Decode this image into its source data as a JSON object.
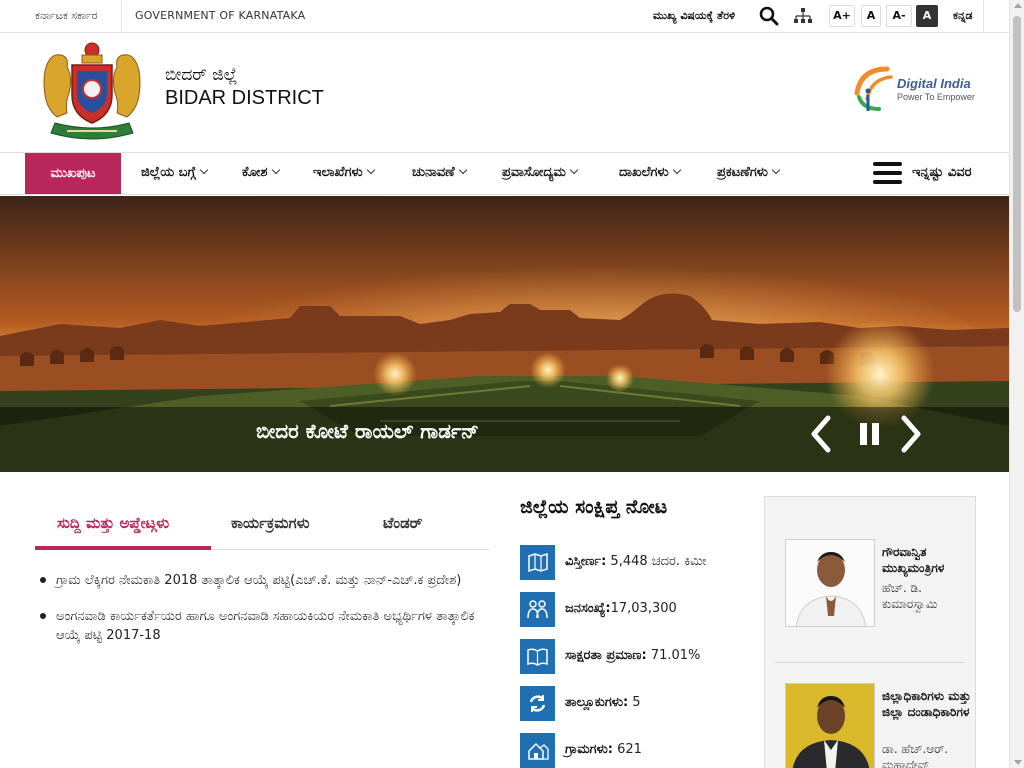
{
  "topbar": {
    "gov_kn": "ಕರ್ನಾಟಕ ಸರ್ಕಾರ",
    "gov_en": "GOVERNMENT OF KARNATAKA",
    "skip_to_main": "ಮುಖ್ಯ ವಿಷಯಕ್ಕೆ ತೆರಳಿ",
    "font_increase": "A+",
    "font_normal": "A",
    "font_decrease": "A-",
    "high_contrast": "A",
    "language": "ಕನ್ನಡ",
    "search_icon": "search-icon",
    "sitemap_icon": "sitemap-icon"
  },
  "header": {
    "title_kn": "ಬೀದರ್ ಜಿಲ್ಲೆ",
    "title_en": "BIDAR DISTRICT",
    "digital_india_title": "Digital India",
    "digital_india_sub": "Power To Empower"
  },
  "nav": {
    "home": "ಮುಖಪುಟ",
    "items": [
      {
        "label": "ಜಿಲ್ಲೆಯ ಬಗ್ಗೆ"
      },
      {
        "label": "ಕೋಶ"
      },
      {
        "label": "ಇಲಾಖೆಗಳು"
      },
      {
        "label": "ಚುನಾವಣೆ"
      },
      {
        "label": "ಪ್ರವಾಸೋದ್ಯಮ"
      },
      {
        "label": "ದಾಖಲೆಗಳು"
      },
      {
        "label": "ಪ್ರಕಟಣೆಗಳು"
      }
    ],
    "more": "ಇನ್ನಷ್ಟು ವಿವರ"
  },
  "banner": {
    "caption": "ಬೀದರ ಕೋಟೆ ರಾಯಲ್ ಗಾರ್ಡನ್",
    "colors": {
      "sky_top": "#4a2a1c",
      "sky_glow": "#e08a3a",
      "ground": "#3e4a22"
    }
  },
  "tabs": {
    "items": [
      {
        "label": "ಸುದ್ದಿ ಮತ್ತು ಅಪ್ಡೇಟ್ಗಳು",
        "active": true
      },
      {
        "label": "ಕಾರ್ಯಕ್ರಮಗಳು",
        "active": false
      },
      {
        "label": "ಟೆಂಡರ್",
        "active": false
      }
    ],
    "news": [
      "ಗ್ರಾಮ ಲೆಕ್ಕಿಗರ ನೇಮಕಾತಿ 2018 ತಾತ್ಕಾಲಿಕ ಆಯ್ಕೆ ಪಟ್ಟಿ(ಎಚ್.ಕೆ. ಮತ್ತು ನಾನ್-ಎಚ್.ಕ ಪ್ರದೇಶ)",
      "ಅಂಗನವಾಡಿ ಕಾರ್ಯಕರ್ತೆಯರ ಹಾಗೂ ಅಂಗನವಾಡಿ ಸಹಾಯಕಿಯರ ನೇಮಕಾತಿ ಅಭ್ಯರ್ಥಿಗಳ ತಾತ್ಕಾಲಿಕ ಆಯ್ಕೆ ಪಟ್ಟಿ 2017-18"
    ]
  },
  "snapshot": {
    "title": "ಜಿಲ್ಲೆಯ ಸಂಕ್ಷಿಪ್ತ ನೋಟ",
    "stats": [
      {
        "label": "ವಿಸ್ತೀರ್ಣ:",
        "value": " 5,448 ಚದರ. ಕಿಮೀ",
        "icon": "map-icon"
      },
      {
        "label": "ಜನಸಂಖ್ಯೆ:",
        "value": "17,03,300",
        "icon": "people-icon"
      },
      {
        "label": "ಸಾಕ್ಷರತಾ ಪ್ರಮಾಣ:",
        "value": " 71.01%",
        "icon": "book-icon"
      },
      {
        "label": "ತಾಲ್ಲೂಕುಗಳು:",
        "value": " 5",
        "icon": "refresh-icon"
      },
      {
        "label": "ಗ್ರಾಮಗಳು:",
        "value": " 621",
        "icon": "village-icon"
      }
    ]
  },
  "dignitaries": [
    {
      "role": "ಗೌರವಾನ್ವಿತ ಮುಖ್ಯಮಂತ್ರಿಗಳ",
      "name": "ಹೆಚ್. ಡಿ. ಕುಮಾರಸ್ವಾಮಿ"
    },
    {
      "role": "ಜಿಲ್ಲಾಧಿಕಾರಿಗಳು ಮತ್ತು ಜಿಲ್ಲಾ ದಂಡಾಧಿಕಾರಿಗಳ",
      "name": "ಡಾ. ಹೆಚ್.ಆರ್. ಮಹಾದೇವ್"
    }
  ]
}
